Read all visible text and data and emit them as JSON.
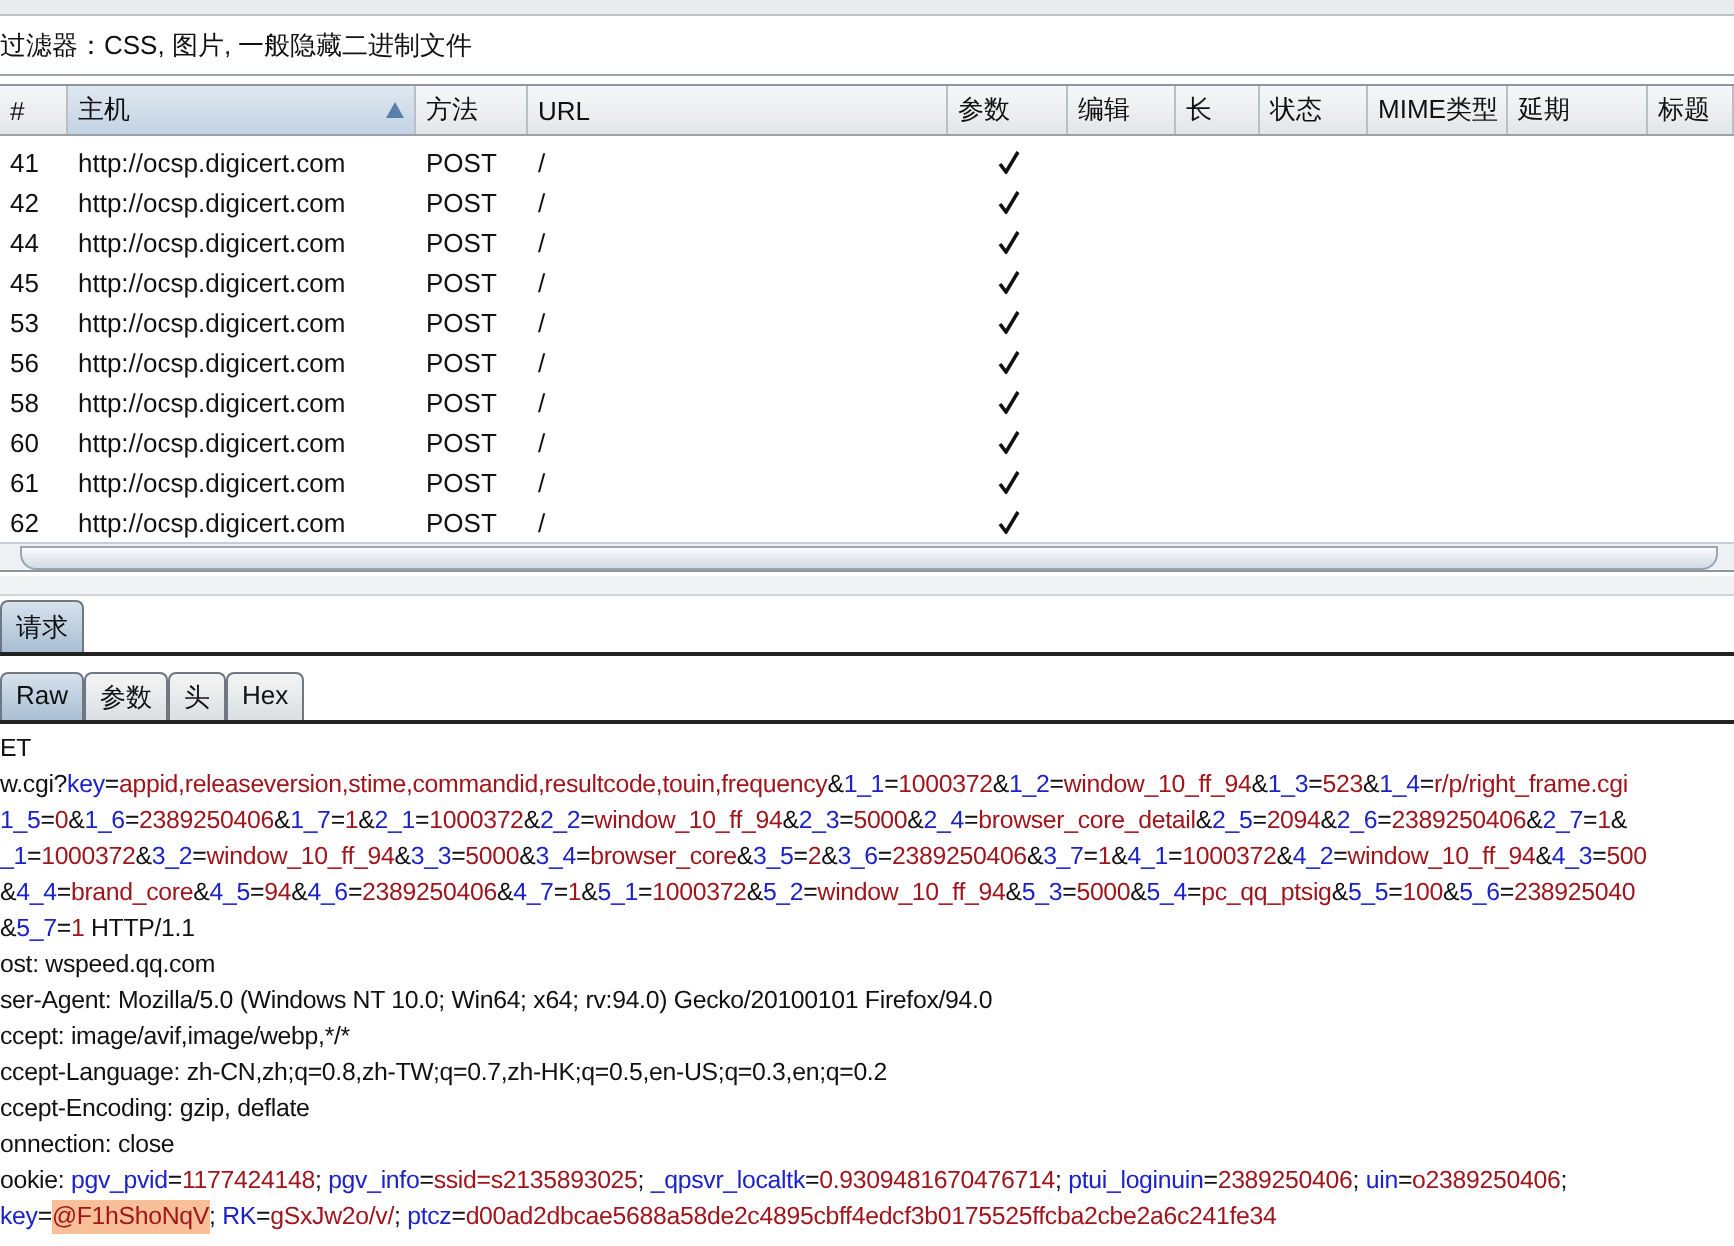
{
  "filter_bar": {
    "text": "过滤器：CSS, 图片, 一般隐藏二进制文件"
  },
  "table": {
    "columns": [
      {
        "label": "#",
        "sorted": false
      },
      {
        "label": "主机",
        "sorted": true
      },
      {
        "label": "方法",
        "sorted": false
      },
      {
        "label": "URL",
        "sorted": false
      },
      {
        "label": "参数",
        "sorted": false
      },
      {
        "label": "编辑",
        "sorted": false
      },
      {
        "label": "长",
        "sorted": false
      },
      {
        "label": "状态",
        "sorted": false
      },
      {
        "label": "MIME类型",
        "sorted": false
      },
      {
        "label": "延期",
        "sorted": false
      },
      {
        "label": "标题",
        "sorted": false
      }
    ],
    "rows": [
      {
        "num": "41",
        "host": "http://ocsp.digicert.com",
        "method": "POST",
        "url": "/",
        "params": true
      },
      {
        "num": "42",
        "host": "http://ocsp.digicert.com",
        "method": "POST",
        "url": "/",
        "params": true
      },
      {
        "num": "44",
        "host": "http://ocsp.digicert.com",
        "method": "POST",
        "url": "/",
        "params": true
      },
      {
        "num": "45",
        "host": "http://ocsp.digicert.com",
        "method": "POST",
        "url": "/",
        "params": true
      },
      {
        "num": "53",
        "host": "http://ocsp.digicert.com",
        "method": "POST",
        "url": "/",
        "params": true
      },
      {
        "num": "56",
        "host": "http://ocsp.digicert.com",
        "method": "POST",
        "url": "/",
        "params": true
      },
      {
        "num": "58",
        "host": "http://ocsp.digicert.com",
        "method": "POST",
        "url": "/",
        "params": true
      },
      {
        "num": "60",
        "host": "http://ocsp.digicert.com",
        "method": "POST",
        "url": "/",
        "params": true
      },
      {
        "num": "61",
        "host": "http://ocsp.digicert.com",
        "method": "POST",
        "url": "/",
        "params": true
      },
      {
        "num": "62",
        "host": "http://ocsp.digicert.com",
        "method": "POST",
        "url": "/",
        "params": true
      }
    ]
  },
  "tabs": [
    {
      "label": "请求",
      "selected": true
    }
  ],
  "subtabs": [
    {
      "label": "Raw",
      "selected": true
    },
    {
      "label": "参数",
      "selected": false
    },
    {
      "label": "头",
      "selected": false
    },
    {
      "label": "Hex",
      "selected": false
    }
  ],
  "request_lines": [
    [
      {
        "kind": "plain",
        "text": "ET"
      }
    ],
    [
      {
        "kind": "plain",
        "text": "w.cgi?"
      },
      {
        "kind": "name",
        "text": "key"
      },
      {
        "kind": "plain",
        "text": "="
      },
      {
        "kind": "value",
        "text": "appid,releaseversion,stime,commandid,resultcode,touin,frequency"
      },
      {
        "kind": "plain",
        "text": "&"
      },
      {
        "kind": "name",
        "text": "1_1"
      },
      {
        "kind": "plain",
        "text": "="
      },
      {
        "kind": "value",
        "text": "1000372"
      },
      {
        "kind": "plain",
        "text": "&"
      },
      {
        "kind": "name",
        "text": "1_2"
      },
      {
        "kind": "plain",
        "text": "="
      },
      {
        "kind": "value",
        "text": "window_10_ff_94"
      },
      {
        "kind": "plain",
        "text": "&"
      },
      {
        "kind": "name",
        "text": "1_3"
      },
      {
        "kind": "plain",
        "text": "="
      },
      {
        "kind": "value",
        "text": "523"
      },
      {
        "kind": "plain",
        "text": "&"
      },
      {
        "kind": "name",
        "text": "1_4"
      },
      {
        "kind": "plain",
        "text": "="
      },
      {
        "kind": "value",
        "text": "r/p/right_frame.cgi"
      }
    ],
    [
      {
        "kind": "name",
        "text": "1_5"
      },
      {
        "kind": "plain",
        "text": "="
      },
      {
        "kind": "value",
        "text": "0"
      },
      {
        "kind": "plain",
        "text": "&"
      },
      {
        "kind": "name",
        "text": "1_6"
      },
      {
        "kind": "plain",
        "text": "="
      },
      {
        "kind": "value",
        "text": "2389250406"
      },
      {
        "kind": "plain",
        "text": "&"
      },
      {
        "kind": "name",
        "text": "1_7"
      },
      {
        "kind": "plain",
        "text": "="
      },
      {
        "kind": "value",
        "text": "1"
      },
      {
        "kind": "plain",
        "text": "&"
      },
      {
        "kind": "name",
        "text": "2_1"
      },
      {
        "kind": "plain",
        "text": "="
      },
      {
        "kind": "value",
        "text": "1000372"
      },
      {
        "kind": "plain",
        "text": "&"
      },
      {
        "kind": "name",
        "text": "2_2"
      },
      {
        "kind": "plain",
        "text": "="
      },
      {
        "kind": "value",
        "text": "window_10_ff_94"
      },
      {
        "kind": "plain",
        "text": "&"
      },
      {
        "kind": "name",
        "text": "2_3"
      },
      {
        "kind": "plain",
        "text": "="
      },
      {
        "kind": "value",
        "text": "5000"
      },
      {
        "kind": "plain",
        "text": "&"
      },
      {
        "kind": "name",
        "text": "2_4"
      },
      {
        "kind": "plain",
        "text": "="
      },
      {
        "kind": "value",
        "text": "browser_core_detail"
      },
      {
        "kind": "plain",
        "text": "&"
      },
      {
        "kind": "name",
        "text": "2_5"
      },
      {
        "kind": "plain",
        "text": "="
      },
      {
        "kind": "value",
        "text": "2094"
      },
      {
        "kind": "plain",
        "text": "&"
      },
      {
        "kind": "name",
        "text": "2_6"
      },
      {
        "kind": "plain",
        "text": "="
      },
      {
        "kind": "value",
        "text": "2389250406"
      },
      {
        "kind": "plain",
        "text": "&"
      },
      {
        "kind": "name",
        "text": "2_7"
      },
      {
        "kind": "plain",
        "text": "="
      },
      {
        "kind": "value",
        "text": "1"
      },
      {
        "kind": "plain",
        "text": "&"
      }
    ],
    [
      {
        "kind": "name",
        "text": "_1"
      },
      {
        "kind": "plain",
        "text": "="
      },
      {
        "kind": "value",
        "text": "1000372"
      },
      {
        "kind": "plain",
        "text": "&"
      },
      {
        "kind": "name",
        "text": "3_2"
      },
      {
        "kind": "plain",
        "text": "="
      },
      {
        "kind": "value",
        "text": "window_10_ff_94"
      },
      {
        "kind": "plain",
        "text": "&"
      },
      {
        "kind": "name",
        "text": "3_3"
      },
      {
        "kind": "plain",
        "text": "="
      },
      {
        "kind": "value",
        "text": "5000"
      },
      {
        "kind": "plain",
        "text": "&"
      },
      {
        "kind": "name",
        "text": "3_4"
      },
      {
        "kind": "plain",
        "text": "="
      },
      {
        "kind": "value",
        "text": "browser_core"
      },
      {
        "kind": "plain",
        "text": "&"
      },
      {
        "kind": "name",
        "text": "3_5"
      },
      {
        "kind": "plain",
        "text": "="
      },
      {
        "kind": "value",
        "text": "2"
      },
      {
        "kind": "plain",
        "text": "&"
      },
      {
        "kind": "name",
        "text": "3_6"
      },
      {
        "kind": "plain",
        "text": "="
      },
      {
        "kind": "value",
        "text": "2389250406"
      },
      {
        "kind": "plain",
        "text": "&"
      },
      {
        "kind": "name",
        "text": "3_7"
      },
      {
        "kind": "plain",
        "text": "="
      },
      {
        "kind": "value",
        "text": "1"
      },
      {
        "kind": "plain",
        "text": "&"
      },
      {
        "kind": "name",
        "text": "4_1"
      },
      {
        "kind": "plain",
        "text": "="
      },
      {
        "kind": "value",
        "text": "1000372"
      },
      {
        "kind": "plain",
        "text": "&"
      },
      {
        "kind": "name",
        "text": "4_2"
      },
      {
        "kind": "plain",
        "text": "="
      },
      {
        "kind": "value",
        "text": "window_10_ff_94"
      },
      {
        "kind": "plain",
        "text": "&"
      },
      {
        "kind": "name",
        "text": "4_3"
      },
      {
        "kind": "plain",
        "text": "="
      },
      {
        "kind": "value",
        "text": "500"
      }
    ],
    [
      {
        "kind": "plain",
        "text": "&"
      },
      {
        "kind": "name",
        "text": "4_4"
      },
      {
        "kind": "plain",
        "text": "="
      },
      {
        "kind": "value",
        "text": "brand_core"
      },
      {
        "kind": "plain",
        "text": "&"
      },
      {
        "kind": "name",
        "text": "4_5"
      },
      {
        "kind": "plain",
        "text": "="
      },
      {
        "kind": "value",
        "text": "94"
      },
      {
        "kind": "plain",
        "text": "&"
      },
      {
        "kind": "name",
        "text": "4_6"
      },
      {
        "kind": "plain",
        "text": "="
      },
      {
        "kind": "value",
        "text": "2389250406"
      },
      {
        "kind": "plain",
        "text": "&"
      },
      {
        "kind": "name",
        "text": "4_7"
      },
      {
        "kind": "plain",
        "text": "="
      },
      {
        "kind": "value",
        "text": "1"
      },
      {
        "kind": "plain",
        "text": "&"
      },
      {
        "kind": "name",
        "text": "5_1"
      },
      {
        "kind": "plain",
        "text": "="
      },
      {
        "kind": "value",
        "text": "1000372"
      },
      {
        "kind": "plain",
        "text": "&"
      },
      {
        "kind": "name",
        "text": "5_2"
      },
      {
        "kind": "plain",
        "text": "="
      },
      {
        "kind": "value",
        "text": "window_10_ff_94"
      },
      {
        "kind": "plain",
        "text": "&"
      },
      {
        "kind": "name",
        "text": "5_3"
      },
      {
        "kind": "plain",
        "text": "="
      },
      {
        "kind": "value",
        "text": "5000"
      },
      {
        "kind": "plain",
        "text": "&"
      },
      {
        "kind": "name",
        "text": "5_4"
      },
      {
        "kind": "plain",
        "text": "="
      },
      {
        "kind": "value",
        "text": "pc_qq_ptsig"
      },
      {
        "kind": "plain",
        "text": "&"
      },
      {
        "kind": "name",
        "text": "5_5"
      },
      {
        "kind": "plain",
        "text": "="
      },
      {
        "kind": "value",
        "text": "100"
      },
      {
        "kind": "plain",
        "text": "&"
      },
      {
        "kind": "name",
        "text": "5_6"
      },
      {
        "kind": "plain",
        "text": "="
      },
      {
        "kind": "value",
        "text": "238925040"
      }
    ],
    [
      {
        "kind": "plain",
        "text": "&"
      },
      {
        "kind": "name",
        "text": "5_7"
      },
      {
        "kind": "plain",
        "text": "="
      },
      {
        "kind": "value",
        "text": "1"
      },
      {
        "kind": "plain",
        "text": " HTTP/1.1"
      }
    ],
    [
      {
        "kind": "plain",
        "text": "ost: wspeed.qq.com"
      }
    ],
    [
      {
        "kind": "plain",
        "text": "ser-Agent: Mozilla/5.0 (Windows NT 10.0; Win64; x64; rv:94.0) Gecko/20100101 Firefox/94.0"
      }
    ],
    [
      {
        "kind": "plain",
        "text": "ccept: image/avif,image/webp,*/*"
      }
    ],
    [
      {
        "kind": "plain",
        "text": "ccept-Language: zh-CN,zh;q=0.8,zh-TW;q=0.7,zh-HK;q=0.5,en-US;q=0.3,en;q=0.2"
      }
    ],
    [
      {
        "kind": "plain",
        "text": "ccept-Encoding: gzip, deflate"
      }
    ],
    [
      {
        "kind": "plain",
        "text": "onnection: close"
      }
    ],
    [
      {
        "kind": "plain",
        "text": "ookie: "
      },
      {
        "kind": "name",
        "text": "pgv_pvid"
      },
      {
        "kind": "plain",
        "text": "="
      },
      {
        "kind": "value",
        "text": "1177424148"
      },
      {
        "kind": "plain",
        "text": "; "
      },
      {
        "kind": "name",
        "text": "pgv_info"
      },
      {
        "kind": "plain",
        "text": "="
      },
      {
        "kind": "value",
        "text": "ssid=s2135893025"
      },
      {
        "kind": "plain",
        "text": "; "
      },
      {
        "kind": "name",
        "text": "_qpsvr_localtk"
      },
      {
        "kind": "plain",
        "text": "="
      },
      {
        "kind": "value",
        "text": "0.9309481670476714"
      },
      {
        "kind": "plain",
        "text": "; "
      },
      {
        "kind": "name",
        "text": "ptui_loginuin"
      },
      {
        "kind": "plain",
        "text": "="
      },
      {
        "kind": "value",
        "text": "2389250406"
      },
      {
        "kind": "plain",
        "text": "; "
      },
      {
        "kind": "name",
        "text": "uin"
      },
      {
        "kind": "plain",
        "text": "="
      },
      {
        "kind": "value",
        "text": "o2389250406"
      },
      {
        "kind": "plain",
        "text": ";"
      }
    ],
    [
      {
        "kind": "name",
        "text": "key"
      },
      {
        "kind": "plain",
        "text": "="
      },
      {
        "kind": "highlight",
        "text": "@F1hShoNqV"
      },
      {
        "kind": "plain",
        "text": "; "
      },
      {
        "kind": "name",
        "text": "RK"
      },
      {
        "kind": "plain",
        "text": "="
      },
      {
        "kind": "value",
        "text": "gSxJw2o/v/"
      },
      {
        "kind": "plain",
        "text": "; "
      },
      {
        "kind": "name",
        "text": "ptcz"
      },
      {
        "kind": "plain",
        "text": "="
      },
      {
        "kind": "value",
        "text": "d00ad2dbcae5688a58de2c4895cbff4edcf3b0175525ffcba2cbe2a6c241fe34"
      }
    ]
  ]
}
